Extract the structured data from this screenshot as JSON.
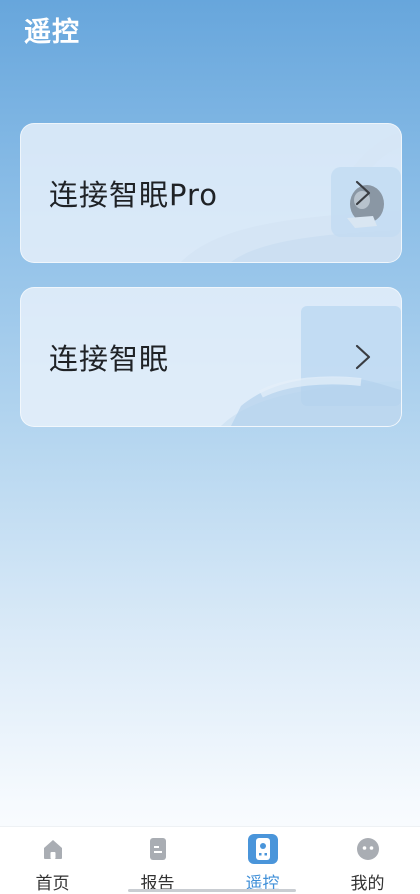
{
  "header": {
    "title": "遥控"
  },
  "cards": [
    {
      "label": "连接智眠Pro"
    },
    {
      "label": "连接智眠"
    }
  ],
  "tabbar": {
    "items": [
      {
        "label": "首页",
        "icon": "home-icon",
        "active": false
      },
      {
        "label": "报告",
        "icon": "report-icon",
        "active": false
      },
      {
        "label": "遥控",
        "icon": "remote-icon",
        "active": true
      },
      {
        "label": "我的",
        "icon": "profile-icon",
        "active": false
      }
    ]
  },
  "colors": {
    "accent": "#3f8fd8",
    "header_bg": "#67a6dc",
    "inactive_icon": "#a9adb3"
  }
}
